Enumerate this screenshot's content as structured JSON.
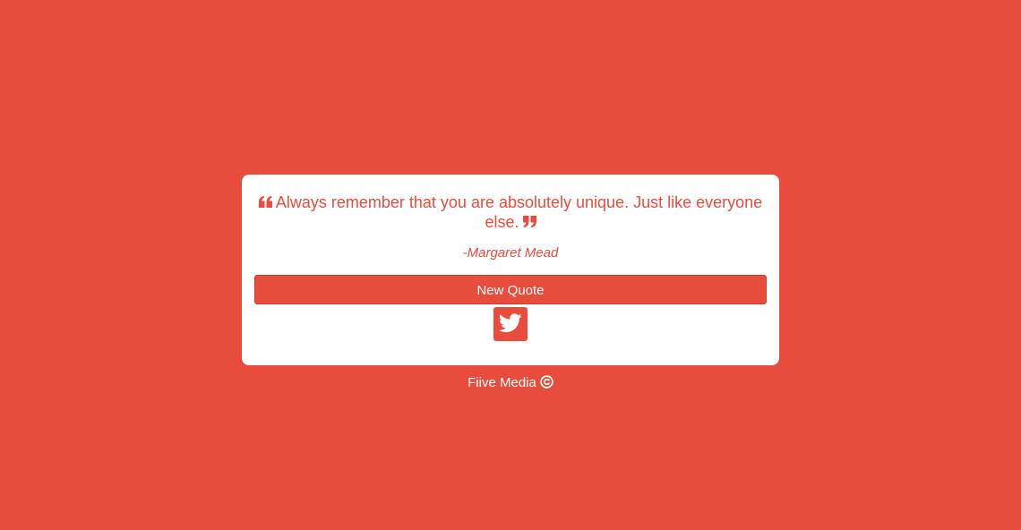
{
  "colors": {
    "accent": "#e74c3c",
    "card_background": "#ffffff",
    "text_on_accent": "#ffffff"
  },
  "quote": {
    "text": "Always remember that you are absolutely unique. Just like everyone else.",
    "author": "-Margaret Mead",
    "open_icon": "quote-left-icon",
    "close_icon": "quote-right-icon"
  },
  "actions": {
    "new_quote_label": "New Quote",
    "tweet_icon": "twitter-icon"
  },
  "footer": {
    "text": "Fiive Media",
    "icon": "copyright-icon"
  }
}
